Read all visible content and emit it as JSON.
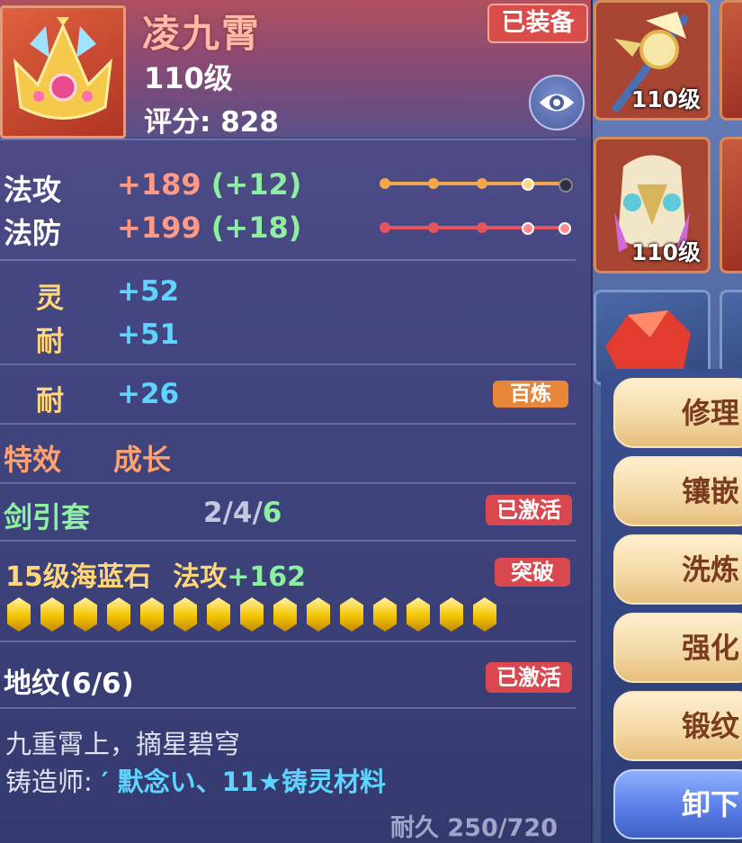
{
  "item": {
    "name": "凌九霄",
    "level": "110级",
    "score_label": "评分:",
    "score": "828",
    "equipped_badge": "已装备"
  },
  "main_stats": [
    {
      "label": "法攻",
      "value": "+189",
      "bonus": "(+12)"
    },
    {
      "label": "法防",
      "value": "+199",
      "bonus": "(+18)"
    }
  ],
  "secondary_stats": [
    {
      "label": "灵",
      "value": "+52"
    },
    {
      "label": "耐",
      "value": "+51"
    }
  ],
  "refine_stat": {
    "label": "耐",
    "value": "+26",
    "badge": "百炼"
  },
  "special": {
    "label": "特效",
    "value": "成长"
  },
  "set": {
    "name": "剑引套",
    "progress_prefix": "2/4/",
    "progress_last": "6",
    "badge": "已激活"
  },
  "gem": {
    "name": "15级海蓝石",
    "stat": "法攻",
    "value": "+162",
    "badge": "突破",
    "count": 15
  },
  "earth_pattern": {
    "label": "地纹(6/6)",
    "badge": "已激活"
  },
  "description": "九重霄上，摘星碧穹",
  "maker": {
    "label": "铸造师:",
    "name": "′ 默念い、11★铸灵材料"
  },
  "durability": "耐久 250/720",
  "inventory": [
    {
      "level": "110级"
    },
    {
      "level": "110级"
    }
  ],
  "actions": {
    "repair": "修理",
    "inlay": "镶嵌",
    "wash": "洗炼",
    "enhance": "强化",
    "forge": "锻纹",
    "unequip": "卸下"
  },
  "colors": {
    "track_orange": "#f2a84a",
    "track_red": "#e5545b",
    "gem_gold": "#f4c400"
  }
}
